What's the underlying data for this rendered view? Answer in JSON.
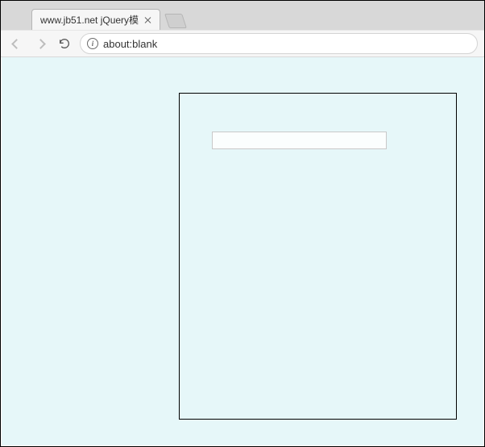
{
  "tab": {
    "title": "www.jb51.net jQuery模",
    "close_label": "Close tab"
  },
  "toolbar": {
    "back_label": "Back",
    "forward_label": "Forward",
    "reload_label": "Reload",
    "new_tab_label": "New tab"
  },
  "address": {
    "info_glyph": "i",
    "url": "about:blank"
  },
  "page": {
    "search_value": "",
    "search_placeholder": ""
  }
}
